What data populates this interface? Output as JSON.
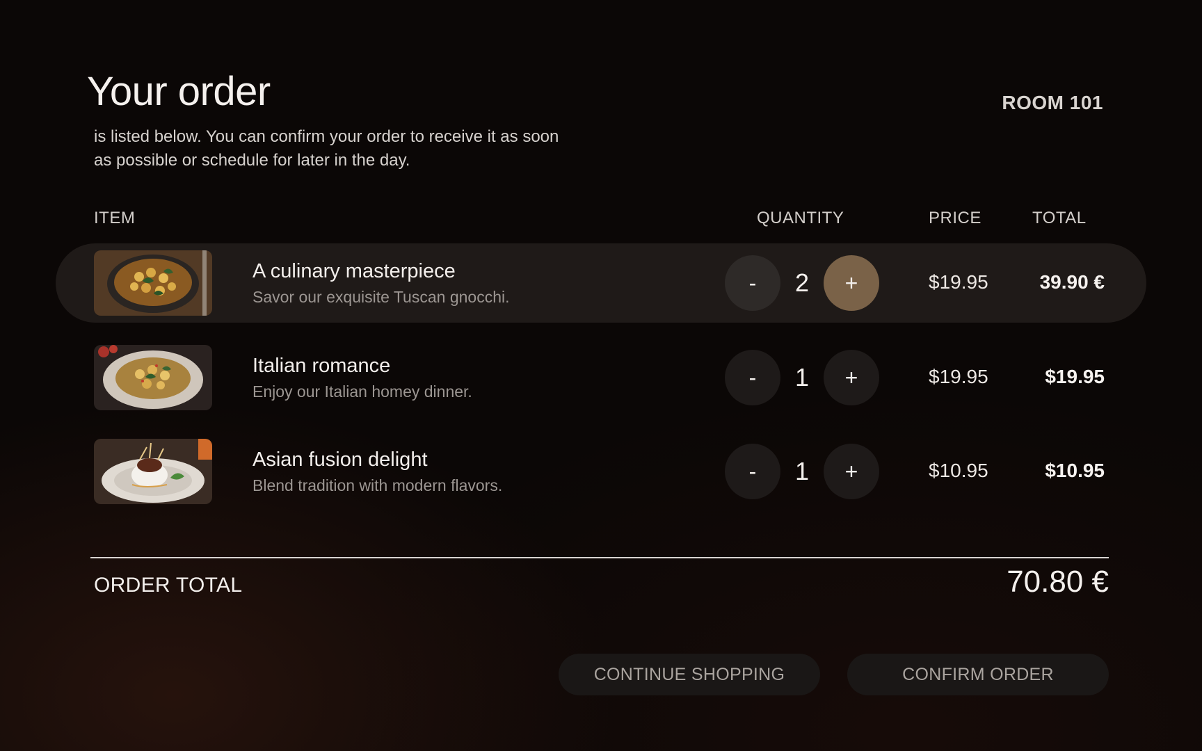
{
  "header": {
    "title": "Your order",
    "subtitle": "is listed below. You can confirm your order to receive it as soon as possible or schedule for later in the day.",
    "room": "ROOM 101"
  },
  "columns": {
    "item": "ITEM",
    "quantity": "QUANTITY",
    "price": "PRICE",
    "total": "TOTAL"
  },
  "items": [
    {
      "name": "A culinary masterpiece",
      "description": "Savor our exquisite Tuscan gnocchi.",
      "quantity": "2",
      "price": "$19.95",
      "total": "39.90 €",
      "minus": "-",
      "plus": "+",
      "selected": true
    },
    {
      "name": "Italian romance",
      "description": "Enjoy our Italian homey dinner.",
      "quantity": "1",
      "price": "$19.95",
      "total": "$19.95",
      "minus": "-",
      "plus": "+",
      "selected": false
    },
    {
      "name": "Asian fusion delight",
      "description": "Blend tradition with modern flavors.",
      "quantity": "1",
      "price": "$10.95",
      "total": "$10.95",
      "minus": "-",
      "plus": "+",
      "selected": false
    }
  ],
  "summary": {
    "label": "ORDER TOTAL",
    "value": "70.80 €"
  },
  "actions": {
    "continue": "CONTINUE SHOPPING",
    "confirm": "CONFIRM ORDER"
  },
  "colors": {
    "background": "#0b0706",
    "active_row": "#1f1a18",
    "accent_plus": "#7a6248",
    "button_bg": "#1a1716"
  }
}
